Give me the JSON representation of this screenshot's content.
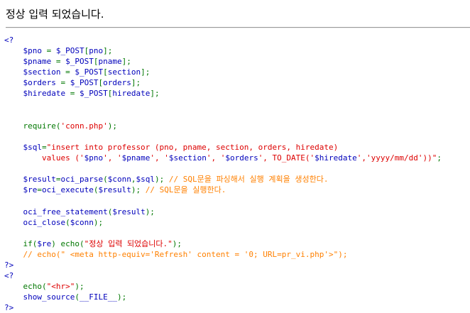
{
  "output": {
    "message": "정상 입력 되었습니다."
  },
  "source": {
    "lines": [
      [
        {
          "t": "tag",
          "s": "<?"
        }
      ],
      [
        {
          "t": "def",
          "s": "    $pno "
        },
        {
          "t": "kw",
          "s": "= "
        },
        {
          "t": "def",
          "s": "$_POST"
        },
        {
          "t": "kw",
          "s": "["
        },
        {
          "t": "def",
          "s": "pno"
        },
        {
          "t": "kw",
          "s": "];"
        }
      ],
      [
        {
          "t": "def",
          "s": "    $pname "
        },
        {
          "t": "kw",
          "s": "= "
        },
        {
          "t": "def",
          "s": "$_POST"
        },
        {
          "t": "kw",
          "s": "["
        },
        {
          "t": "def",
          "s": "pname"
        },
        {
          "t": "kw",
          "s": "];"
        }
      ],
      [
        {
          "t": "def",
          "s": "    $section "
        },
        {
          "t": "kw",
          "s": "= "
        },
        {
          "t": "def",
          "s": "$_POST"
        },
        {
          "t": "kw",
          "s": "["
        },
        {
          "t": "def",
          "s": "section"
        },
        {
          "t": "kw",
          "s": "];"
        }
      ],
      [
        {
          "t": "def",
          "s": "    $orders "
        },
        {
          "t": "kw",
          "s": "= "
        },
        {
          "t": "def",
          "s": "$_POST"
        },
        {
          "t": "kw",
          "s": "["
        },
        {
          "t": "def",
          "s": "orders"
        },
        {
          "t": "kw",
          "s": "];"
        }
      ],
      [
        {
          "t": "def",
          "s": "    $hiredate "
        },
        {
          "t": "kw",
          "s": "= "
        },
        {
          "t": "def",
          "s": "$_POST"
        },
        {
          "t": "kw",
          "s": "["
        },
        {
          "t": "def",
          "s": "hiredate"
        },
        {
          "t": "kw",
          "s": "];"
        }
      ],
      [],
      [],
      [
        {
          "t": "kw",
          "s": "    require("
        },
        {
          "t": "str",
          "s": "'conn.php'"
        },
        {
          "t": "kw",
          "s": ");"
        }
      ],
      [],
      [
        {
          "t": "def",
          "s": "    $sql"
        },
        {
          "t": "kw",
          "s": "="
        },
        {
          "t": "str",
          "s": "\"insert into professor (pno, pname, section, orders, hiredate)"
        }
      ],
      [
        {
          "t": "str",
          "s": "        values ('"
        },
        {
          "t": "def",
          "s": "$pno"
        },
        {
          "t": "str",
          "s": "', '"
        },
        {
          "t": "def",
          "s": "$pname"
        },
        {
          "t": "str",
          "s": "', '"
        },
        {
          "t": "def",
          "s": "$section"
        },
        {
          "t": "str",
          "s": "', '"
        },
        {
          "t": "def",
          "s": "$orders"
        },
        {
          "t": "str",
          "s": "', TO_DATE('"
        },
        {
          "t": "def",
          "s": "$hiredate"
        },
        {
          "t": "str",
          "s": "','yyyy/mm/dd'))\""
        },
        {
          "t": "kw",
          "s": ";"
        }
      ],
      [],
      [
        {
          "t": "def",
          "s": "    $result"
        },
        {
          "t": "kw",
          "s": "="
        },
        {
          "t": "def",
          "s": "oci_parse"
        },
        {
          "t": "kw",
          "s": "("
        },
        {
          "t": "def",
          "s": "$conn"
        },
        {
          "t": "kw",
          "s": ","
        },
        {
          "t": "def",
          "s": "$sql"
        },
        {
          "t": "kw",
          "s": "); "
        },
        {
          "t": "cmt",
          "s": "// SQL문을 파싱해서 실행 계획을 생성한다."
        }
      ],
      [
        {
          "t": "def",
          "s": "    $re"
        },
        {
          "t": "kw",
          "s": "="
        },
        {
          "t": "def",
          "s": "oci_execute"
        },
        {
          "t": "kw",
          "s": "("
        },
        {
          "t": "def",
          "s": "$result"
        },
        {
          "t": "kw",
          "s": "); "
        },
        {
          "t": "cmt",
          "s": "// SQL문을 실행한다."
        }
      ],
      [],
      [
        {
          "t": "def",
          "s": "    oci_free_statement"
        },
        {
          "t": "kw",
          "s": "("
        },
        {
          "t": "def",
          "s": "$result"
        },
        {
          "t": "kw",
          "s": ");"
        }
      ],
      [
        {
          "t": "def",
          "s": "    oci_close"
        },
        {
          "t": "kw",
          "s": "("
        },
        {
          "t": "def",
          "s": "$conn"
        },
        {
          "t": "kw",
          "s": ");"
        }
      ],
      [],
      [
        {
          "t": "kw",
          "s": "    if("
        },
        {
          "t": "def",
          "s": "$re"
        },
        {
          "t": "kw",
          "s": ") echo("
        },
        {
          "t": "str",
          "s": "\"정상 입력 되었습니다.\""
        },
        {
          "t": "kw",
          "s": ");"
        }
      ],
      [
        {
          "t": "cmt",
          "s": "    // echo(\" <meta http-equiv='Refresh' content = '0; URL=pr_vi.php'>\");"
        }
      ],
      [
        {
          "t": "tag",
          "s": "?>"
        }
      ],
      [
        {
          "t": "tag",
          "s": "<?"
        }
      ],
      [
        {
          "t": "kw",
          "s": "    echo("
        },
        {
          "t": "str",
          "s": "\"<hr>\""
        },
        {
          "t": "kw",
          "s": ");"
        }
      ],
      [
        {
          "t": "def",
          "s": "    show_source"
        },
        {
          "t": "kw",
          "s": "("
        },
        {
          "t": "def",
          "s": "__FILE__"
        },
        {
          "t": "kw",
          "s": ");"
        }
      ],
      [
        {
          "t": "tag",
          "s": "?>"
        }
      ]
    ]
  }
}
